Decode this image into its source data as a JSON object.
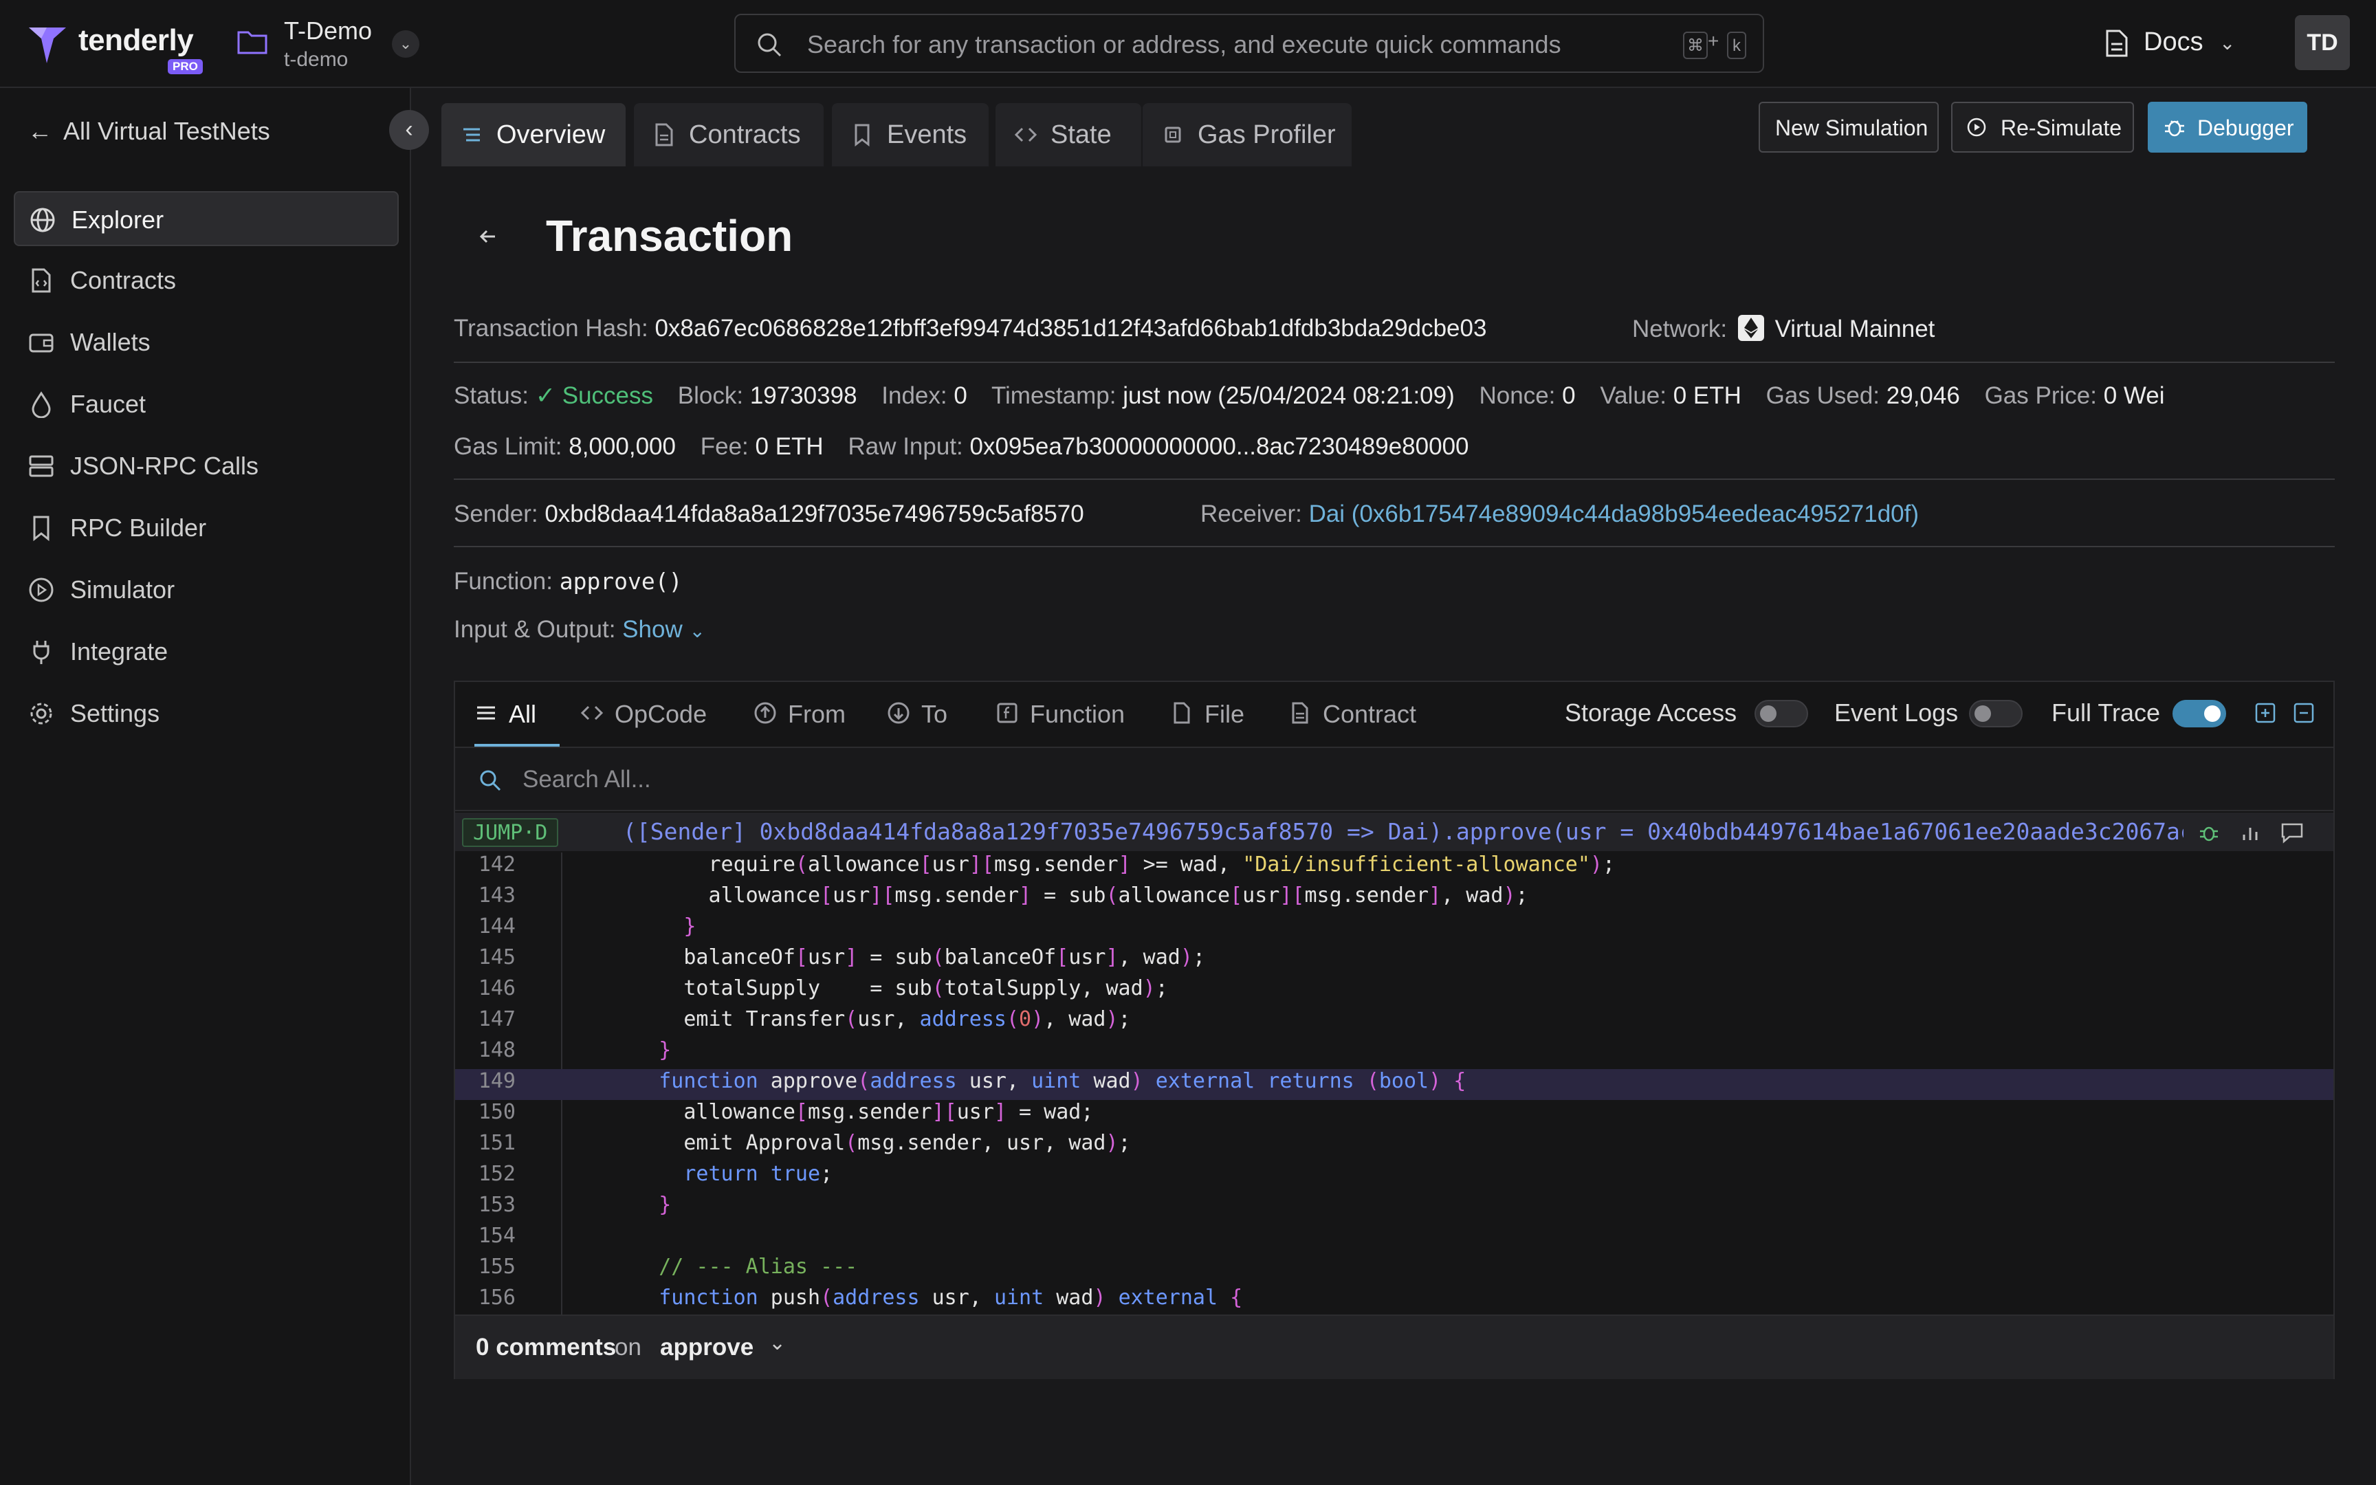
{
  "brand": {
    "name": "tenderly",
    "badge": "PRO"
  },
  "project": {
    "name": "T-Demo",
    "slug": "t-demo"
  },
  "search": {
    "placeholder": "Search for any transaction or address, and execute quick commands",
    "shortcut_mod": "⌘",
    "shortcut_plus": "+",
    "shortcut_key": "k"
  },
  "header": {
    "docs_label": "Docs",
    "avatar_initials": "TD"
  },
  "sidebar": {
    "back_label": "All Virtual TestNets",
    "items": [
      {
        "label": "Explorer",
        "icon": "globe-icon",
        "active": true
      },
      {
        "label": "Contracts",
        "icon": "contract-file-icon"
      },
      {
        "label": "Wallets",
        "icon": "wallet-icon"
      },
      {
        "label": "Faucet",
        "icon": "droplet-icon"
      },
      {
        "label": "JSON-RPC Calls",
        "icon": "server-icon"
      },
      {
        "label": "RPC Builder",
        "icon": "bookmark-icon"
      },
      {
        "label": "Simulator",
        "icon": "play-circle-icon"
      },
      {
        "label": "Integrate",
        "icon": "plug-icon"
      },
      {
        "label": "Settings",
        "icon": "gear-icon"
      }
    ]
  },
  "tabs": [
    {
      "label": "Overview",
      "icon": "list-icon",
      "active": true
    },
    {
      "label": "Contracts",
      "icon": "file-icon"
    },
    {
      "label": "Events",
      "icon": "bookmark-icon"
    },
    {
      "label": "State",
      "icon": "code-icon"
    },
    {
      "label": "Gas Profiler",
      "icon": "chip-icon"
    }
  ],
  "actions": {
    "new_simulation": "New Simulation",
    "resimulate": "Re-Simulate",
    "debugger": "Debugger"
  },
  "page": {
    "title": "Transaction"
  },
  "tx": {
    "hash_label": "Transaction Hash:",
    "hash": "0x8a67ec0686828e12fbff3ef99474d3851d12f43afd66bab1dfdb3bda29dcbe03",
    "network_label": "Network:",
    "network": "Virtual Mainnet",
    "status_label": "Status:",
    "status": "Success",
    "block_label": "Block:",
    "block": "19730398",
    "index_label": "Index:",
    "index": "0",
    "timestamp_label": "Timestamp:",
    "timestamp": "just now (25/04/2024 08:21:09)",
    "nonce_label": "Nonce:",
    "nonce": "0",
    "value_label": "Value:",
    "value": "0 ETH",
    "gas_used_label": "Gas Used:",
    "gas_used": "29,046",
    "gas_price_label": "Gas Price:",
    "gas_price": "0 Wei",
    "gas_limit_label": "Gas Limit:",
    "gas_limit": "8,000,000",
    "fee_label": "Fee:",
    "fee": "0 ETH",
    "raw_input_label": "Raw Input:",
    "raw_input": "0x095ea7b30000000000...8ac7230489e80000",
    "sender_label": "Sender:",
    "sender": "0xbd8daa414fda8a8a129f7035e7496759c5af8570",
    "receiver_label": "Receiver:",
    "receiver": "Dai (0x6b175474e89094c44da98b954eedeac495271d0f)",
    "function_label": "Function:",
    "function": "approve()",
    "io_label": "Input & Output:",
    "io_toggle": "Show"
  },
  "trace": {
    "tabs": [
      {
        "label": "All",
        "icon": "list-icon",
        "active": true
      },
      {
        "label": "OpCode",
        "icon": "code-icon"
      },
      {
        "label": "From",
        "icon": "arrow-up-circle-icon"
      },
      {
        "label": "To",
        "icon": "arrow-down-circle-icon"
      },
      {
        "label": "Function",
        "icon": "function-icon"
      },
      {
        "label": "File",
        "icon": "file-icon"
      },
      {
        "label": "Contract",
        "icon": "contract-file-icon"
      }
    ],
    "toggles": [
      {
        "label": "Storage Access",
        "on": false
      },
      {
        "label": "Event Logs",
        "on": false
      },
      {
        "label": "Full Trace",
        "on": true
      }
    ],
    "search_placeholder": "Search All...",
    "jump_badge": "JUMP·D",
    "jump_text": "([Sender] 0xbd8daa414fda8a8a129f7035e7496759c5af8570 => Dai).approve(usr = 0x40bdb4497614bae1a67061ee20aade3c2067ac",
    "highlighted_line": "149",
    "code_lines": [
      {
        "n": "142",
        "text": "        require(allowance[usr][msg.sender] >= wad, \"Dai/insufficient-allowance\");"
      },
      {
        "n": "143",
        "text": "        allowance[usr][msg.sender] = sub(allowance[usr][msg.sender], wad);"
      },
      {
        "n": "144",
        "text": "      }"
      },
      {
        "n": "145",
        "text": "      balanceOf[usr] = sub(balanceOf[usr], wad);"
      },
      {
        "n": "146",
        "text": "      totalSupply    = sub(totalSupply, wad);"
      },
      {
        "n": "147",
        "text": "      emit Transfer(usr, address(0), wad);"
      },
      {
        "n": "148",
        "text": "    }"
      },
      {
        "n": "149",
        "text": "    function approve(address usr, uint wad) external returns (bool) {"
      },
      {
        "n": "150",
        "text": "      allowance[msg.sender][usr] = wad;"
      },
      {
        "n": "151",
        "text": "      emit Approval(msg.sender, usr, wad);"
      },
      {
        "n": "152",
        "text": "      return true;"
      },
      {
        "n": "153",
        "text": "    }"
      },
      {
        "n": "154",
        "text": ""
      },
      {
        "n": "155",
        "text": "    // --- Alias ---"
      },
      {
        "n": "156",
        "text": "    function push(address usr, uint wad) external {"
      }
    ],
    "comments_count": "0 comments",
    "comments_on": "on",
    "comments_target": "approve"
  },
  "colors": {
    "accent": "#3d86b0",
    "success": "#4fbf79",
    "link": "#6fb2da",
    "brand": "#7b5cf6"
  }
}
